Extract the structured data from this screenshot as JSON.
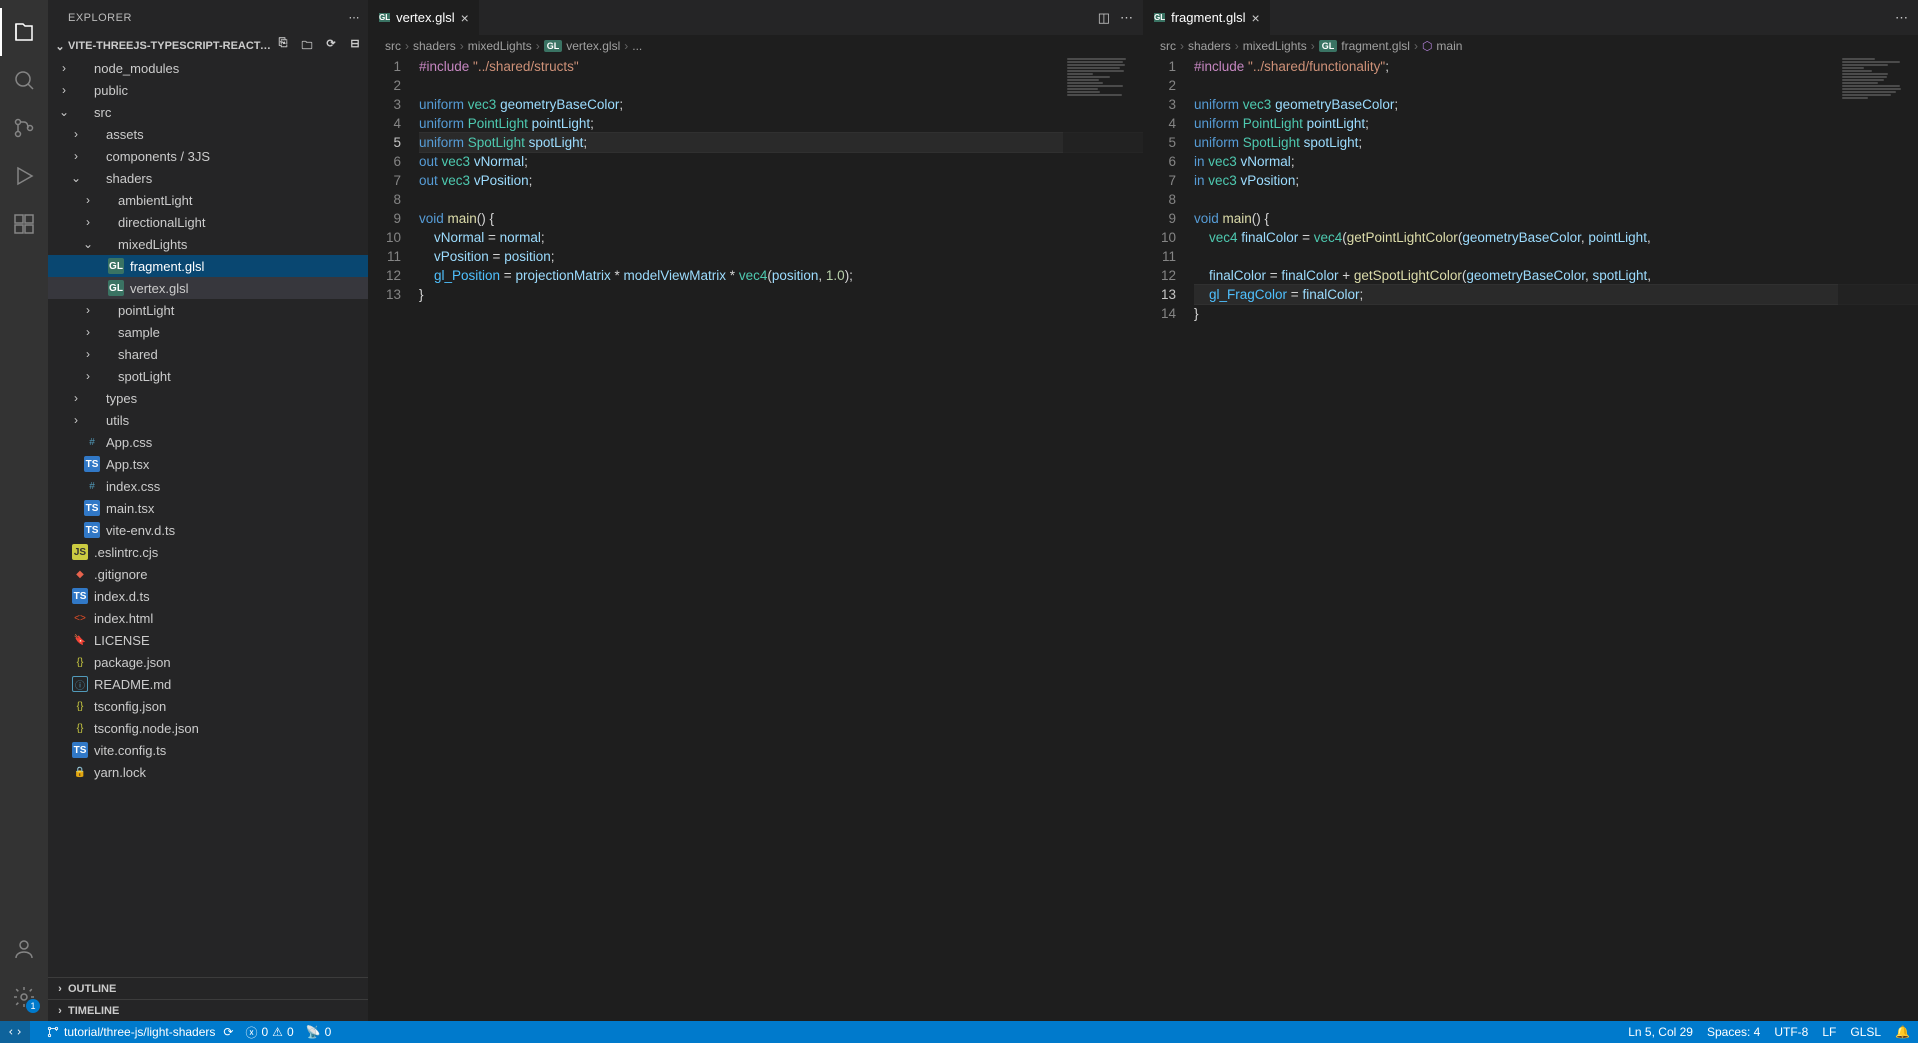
{
  "sidebar_title": "EXPLORER",
  "project_name": "VITE-THREEJS-TYPESCRIPT-REACT-GLSL-STARTER-...",
  "tree": [
    {
      "depth": 0,
      "chev": "right",
      "icon": "folder",
      "label": "node_modules"
    },
    {
      "depth": 0,
      "chev": "right",
      "icon": "folder",
      "label": "public"
    },
    {
      "depth": 0,
      "chev": "down",
      "icon": "folder",
      "label": "src"
    },
    {
      "depth": 1,
      "chev": "right",
      "icon": "folder",
      "label": "assets"
    },
    {
      "depth": 1,
      "chev": "right",
      "icon": "folder",
      "label": "components / 3JS"
    },
    {
      "depth": 1,
      "chev": "down",
      "icon": "folder",
      "label": "shaders"
    },
    {
      "depth": 2,
      "chev": "right",
      "icon": "folder",
      "label": "ambientLight"
    },
    {
      "depth": 2,
      "chev": "right",
      "icon": "folder",
      "label": "directionalLight"
    },
    {
      "depth": 2,
      "chev": "down",
      "icon": "folder",
      "label": "mixedLights"
    },
    {
      "depth": 3,
      "chev": "",
      "icon": "gl",
      "label": "fragment.glsl",
      "sel": "selected"
    },
    {
      "depth": 3,
      "chev": "",
      "icon": "gl",
      "label": "vertex.glsl",
      "sel": "selected2"
    },
    {
      "depth": 2,
      "chev": "right",
      "icon": "folder",
      "label": "pointLight"
    },
    {
      "depth": 2,
      "chev": "right",
      "icon": "folder",
      "label": "sample"
    },
    {
      "depth": 2,
      "chev": "right",
      "icon": "folder",
      "label": "shared"
    },
    {
      "depth": 2,
      "chev": "right",
      "icon": "folder",
      "label": "spotLight"
    },
    {
      "depth": 1,
      "chev": "right",
      "icon": "folder",
      "label": "types"
    },
    {
      "depth": 1,
      "chev": "right",
      "icon": "folder",
      "label": "utils"
    },
    {
      "depth": 1,
      "chev": "",
      "icon": "hash",
      "label": "App.css"
    },
    {
      "depth": 1,
      "chev": "",
      "icon": "ts",
      "label": "App.tsx"
    },
    {
      "depth": 1,
      "chev": "",
      "icon": "hash",
      "label": "index.css"
    },
    {
      "depth": 1,
      "chev": "",
      "icon": "ts",
      "label": "main.tsx"
    },
    {
      "depth": 1,
      "chev": "",
      "icon": "ts",
      "label": "vite-env.d.ts"
    },
    {
      "depth": 0,
      "chev": "",
      "icon": "js",
      "label": ".eslintrc.cjs"
    },
    {
      "depth": 0,
      "chev": "",
      "icon": "git",
      "label": ".gitignore"
    },
    {
      "depth": 0,
      "chev": "",
      "icon": "ts",
      "label": "index.d.ts"
    },
    {
      "depth": 0,
      "chev": "",
      "icon": "html",
      "label": "index.html"
    },
    {
      "depth": 0,
      "chev": "",
      "icon": "lic",
      "label": "LICENSE"
    },
    {
      "depth": 0,
      "chev": "",
      "icon": "json",
      "label": "package.json"
    },
    {
      "depth": 0,
      "chev": "",
      "icon": "info",
      "label": "README.md"
    },
    {
      "depth": 0,
      "chev": "",
      "icon": "json",
      "label": "tsconfig.json"
    },
    {
      "depth": 0,
      "chev": "",
      "icon": "json",
      "label": "tsconfig.node.json"
    },
    {
      "depth": 0,
      "chev": "",
      "icon": "ts",
      "label": "vite.config.ts"
    },
    {
      "depth": 0,
      "chev": "",
      "icon": "lock",
      "label": "yarn.lock"
    }
  ],
  "outline_label": "OUTLINE",
  "timeline_label": "TIMELINE",
  "editors": [
    {
      "tab": "vertex.glsl",
      "breadcrumb": [
        "src",
        "shaders",
        "mixedLights",
        "vertex.glsl",
        "..."
      ],
      "current_line": 5,
      "lines": [
        [
          {
            "t": "#include ",
            "c": "pre"
          },
          {
            "t": "\"../shared/structs\"",
            "c": "str"
          }
        ],
        [],
        [
          {
            "t": "uniform ",
            "c": "kw"
          },
          {
            "t": "vec3 ",
            "c": "type"
          },
          {
            "t": "geometryBaseColor",
            "c": "ident"
          },
          {
            "t": ";",
            "c": "op"
          }
        ],
        [
          {
            "t": "uniform ",
            "c": "kw"
          },
          {
            "t": "PointLight ",
            "c": "type"
          },
          {
            "t": "pointLight",
            "c": "ident"
          },
          {
            "t": ";",
            "c": "op"
          }
        ],
        [
          {
            "t": "uniform ",
            "c": "kw"
          },
          {
            "t": "SpotLight ",
            "c": "type"
          },
          {
            "t": "spotLight",
            "c": "ident"
          },
          {
            "t": ";",
            "c": "op"
          }
        ],
        [
          {
            "t": "out ",
            "c": "kw"
          },
          {
            "t": "vec3 ",
            "c": "type"
          },
          {
            "t": "vNormal",
            "c": "ident"
          },
          {
            "t": ";",
            "c": "op"
          }
        ],
        [
          {
            "t": "out ",
            "c": "kw"
          },
          {
            "t": "vec3 ",
            "c": "type"
          },
          {
            "t": "vPosition",
            "c": "ident"
          },
          {
            "t": ";",
            "c": "op"
          }
        ],
        [],
        [
          {
            "t": "void ",
            "c": "kw"
          },
          {
            "t": "main",
            "c": "func"
          },
          {
            "t": "() {",
            "c": "op"
          }
        ],
        [
          {
            "t": "    vNormal ",
            "c": "ident"
          },
          {
            "t": "= ",
            "c": "op"
          },
          {
            "t": "normal",
            "c": "ident"
          },
          {
            "t": ";",
            "c": "op"
          }
        ],
        [
          {
            "t": "    vPosition ",
            "c": "ident"
          },
          {
            "t": "= ",
            "c": "op"
          },
          {
            "t": "position",
            "c": "ident"
          },
          {
            "t": ";",
            "c": "op"
          }
        ],
        [
          {
            "t": "    gl_Position ",
            "c": "builtin"
          },
          {
            "t": "= ",
            "c": "op"
          },
          {
            "t": "projectionMatrix ",
            "c": "ident"
          },
          {
            "t": "* ",
            "c": "op"
          },
          {
            "t": "modelViewMatrix ",
            "c": "ident"
          },
          {
            "t": "* ",
            "c": "op"
          },
          {
            "t": "vec4",
            "c": "type"
          },
          {
            "t": "(",
            "c": "op"
          },
          {
            "t": "position",
            "c": "ident"
          },
          {
            "t": ", ",
            "c": "op"
          },
          {
            "t": "1.0",
            "c": "num"
          },
          {
            "t": ");",
            "c": "op"
          }
        ],
        [
          {
            "t": "}",
            "c": "op"
          }
        ]
      ]
    },
    {
      "tab": "fragment.glsl",
      "breadcrumb": [
        "src",
        "shaders",
        "mixedLights",
        "fragment.glsl",
        "main"
      ],
      "current_line": 13,
      "lines": [
        [
          {
            "t": "#include ",
            "c": "pre"
          },
          {
            "t": "\"../shared/functionality\"",
            "c": "str"
          },
          {
            "t": ";",
            "c": "op"
          }
        ],
        [],
        [
          {
            "t": "uniform ",
            "c": "kw"
          },
          {
            "t": "vec3 ",
            "c": "type"
          },
          {
            "t": "geometryBaseColor",
            "c": "ident"
          },
          {
            "t": ";",
            "c": "op"
          }
        ],
        [
          {
            "t": "uniform ",
            "c": "kw"
          },
          {
            "t": "PointLight ",
            "c": "type"
          },
          {
            "t": "pointLight",
            "c": "ident"
          },
          {
            "t": ";",
            "c": "op"
          }
        ],
        [
          {
            "t": "uniform ",
            "c": "kw"
          },
          {
            "t": "SpotLight ",
            "c": "type"
          },
          {
            "t": "spotLight",
            "c": "ident"
          },
          {
            "t": ";",
            "c": "op"
          }
        ],
        [
          {
            "t": "in ",
            "c": "kw"
          },
          {
            "t": "vec3 ",
            "c": "type"
          },
          {
            "t": "vNormal",
            "c": "ident"
          },
          {
            "t": ";",
            "c": "op"
          }
        ],
        [
          {
            "t": "in ",
            "c": "kw"
          },
          {
            "t": "vec3 ",
            "c": "type"
          },
          {
            "t": "vPosition",
            "c": "ident"
          },
          {
            "t": ";",
            "c": "op"
          }
        ],
        [],
        [
          {
            "t": "void ",
            "c": "kw"
          },
          {
            "t": "main",
            "c": "func"
          },
          {
            "t": "() {",
            "c": "op"
          }
        ],
        [
          {
            "t": "    vec4 ",
            "c": "type"
          },
          {
            "t": "finalColor ",
            "c": "ident"
          },
          {
            "t": "= ",
            "c": "op"
          },
          {
            "t": "vec4",
            "c": "type"
          },
          {
            "t": "(",
            "c": "op"
          },
          {
            "t": "getPointLightColor",
            "c": "func"
          },
          {
            "t": "(",
            "c": "op"
          },
          {
            "t": "geometryBaseColor",
            "c": "ident"
          },
          {
            "t": ", ",
            "c": "op"
          },
          {
            "t": "pointLight",
            "c": "ident"
          },
          {
            "t": ",",
            "c": "op"
          }
        ],
        [],
        [
          {
            "t": "    finalColor ",
            "c": "ident"
          },
          {
            "t": "= ",
            "c": "op"
          },
          {
            "t": "finalColor ",
            "c": "ident"
          },
          {
            "t": "+ ",
            "c": "op"
          },
          {
            "t": "getSpotLightColor",
            "c": "func"
          },
          {
            "t": "(",
            "c": "op"
          },
          {
            "t": "geometryBaseColor",
            "c": "ident"
          },
          {
            "t": ", ",
            "c": "op"
          },
          {
            "t": "spotLight",
            "c": "ident"
          },
          {
            "t": ",",
            "c": "op"
          }
        ],
        [
          {
            "t": "    gl_FragColor ",
            "c": "builtin"
          },
          {
            "t": "= ",
            "c": "op"
          },
          {
            "t": "finalColor",
            "c": "ident"
          },
          {
            "t": ";",
            "c": "op"
          }
        ],
        [
          {
            "t": "}",
            "c": "op"
          }
        ]
      ]
    }
  ],
  "status": {
    "branch": "tutorial/three-js/light-shaders",
    "errors": "0",
    "warnings": "0",
    "ports": "0",
    "cursor": "Ln 5, Col 29",
    "spaces": "Spaces: 4",
    "encoding": "UTF-8",
    "eol": "LF",
    "lang": "GLSL"
  },
  "settings_badge": "1"
}
